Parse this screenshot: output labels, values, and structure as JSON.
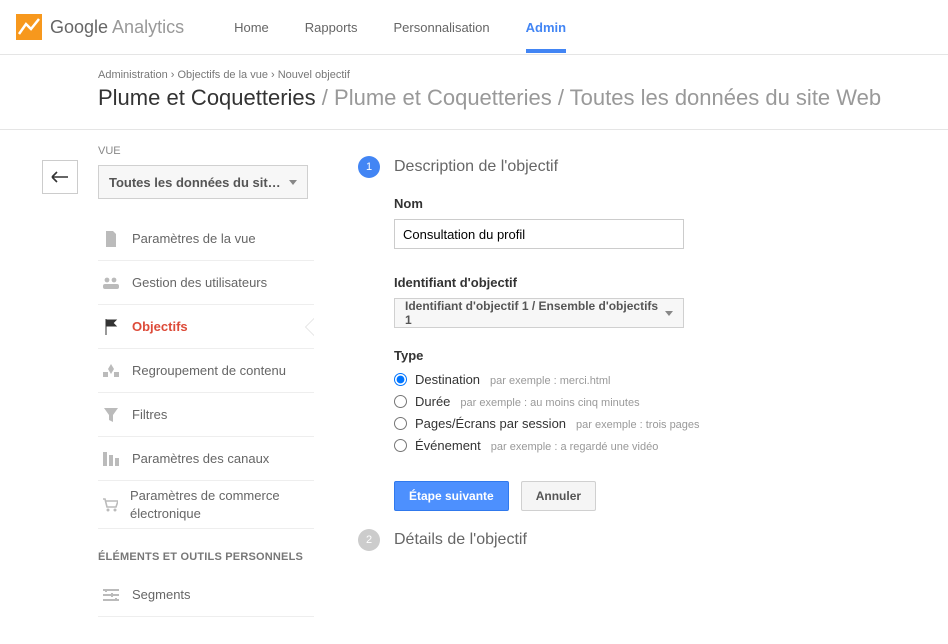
{
  "header": {
    "logo_google": "Google",
    "logo_analytics": "Analytics",
    "nav": {
      "home": "Home",
      "reports": "Rapports",
      "custom": "Personnalisation",
      "admin": "Admin"
    }
  },
  "breadcrumb": "Administration  ›  Objectifs de la vue  ›  Nouvel objectif",
  "title": {
    "account": "Plume et Coquetteries",
    "property": "Plume et Coquetteries",
    "view": "Toutes les données du site Web"
  },
  "sidebar": {
    "view_label": "VUE",
    "view_select": "Toutes les données du sit…",
    "items": [
      {
        "label": "Paramètres de la vue",
        "icon": "file"
      },
      {
        "label": "Gestion des utilisateurs",
        "icon": "users"
      },
      {
        "label": "Objectifs",
        "icon": "flag",
        "active": true
      },
      {
        "label": "Regroupement de contenu",
        "icon": "group"
      },
      {
        "label": "Filtres",
        "icon": "filter"
      },
      {
        "label": "Paramètres des canaux",
        "icon": "channels"
      },
      {
        "label": "Paramètres de commerce électronique",
        "icon": "cart"
      }
    ],
    "section_head": "ÉLÉMENTS ET OUTILS PERSONNELS",
    "segments": "Segments"
  },
  "main": {
    "step1_title": "Description de l'objectif",
    "step2_title": "Détails de l'objectif",
    "labels": {
      "name": "Nom",
      "goal_id": "Identifiant d'objectif",
      "type": "Type"
    },
    "name_value": "Consultation du profil",
    "goal_id_select": "Identifiant d'objectif 1 / Ensemble d'objectifs 1",
    "types": {
      "destination": {
        "label": "Destination",
        "hint": "par exemple : merci.html"
      },
      "duration": {
        "label": "Durée",
        "hint": "par exemple : au moins cinq minutes"
      },
      "pages": {
        "label": "Pages/Écrans par session",
        "hint": "par exemple : trois pages"
      },
      "event": {
        "label": "Événement",
        "hint": "par exemple : a regardé une vidéo"
      }
    },
    "buttons": {
      "next": "Étape suivante",
      "cancel": "Annuler"
    }
  }
}
